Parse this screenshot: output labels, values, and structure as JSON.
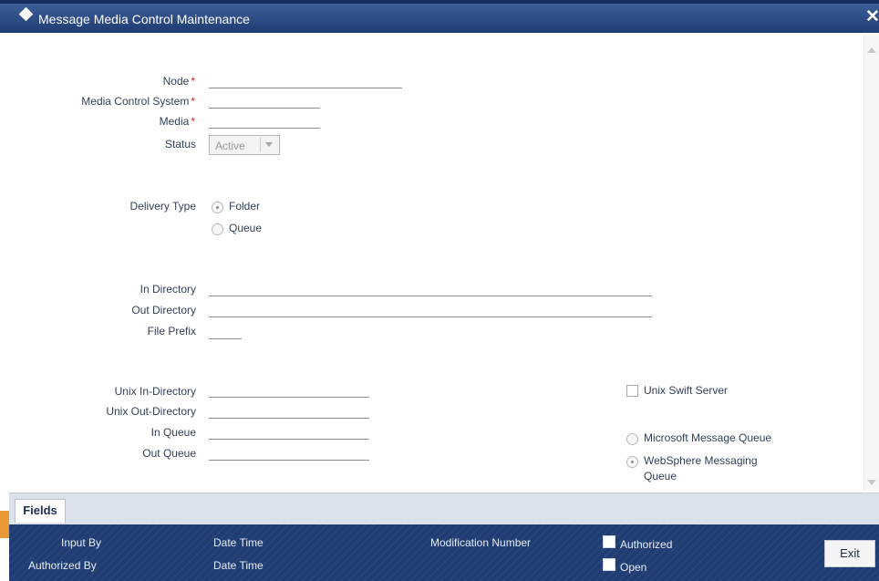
{
  "window": {
    "title": "Message Media Control Maintenance",
    "close_glyph": "✕"
  },
  "form": {
    "node": {
      "label": "Node",
      "required_mark": "*",
      "value": ""
    },
    "media_control_system": {
      "label": "Media Control System",
      "required_mark": "*",
      "value": ""
    },
    "media": {
      "label": "Media",
      "required_mark": "*",
      "value": ""
    },
    "status": {
      "label": "Status",
      "value": "Active"
    },
    "delivery_type": {
      "label": "Delivery Type",
      "options": [
        {
          "label": "Folder",
          "selected": true
        },
        {
          "label": "Queue",
          "selected": false
        }
      ]
    },
    "in_directory": {
      "label": "In Directory",
      "value": ""
    },
    "out_directory": {
      "label": "Out Directory",
      "value": ""
    },
    "file_prefix": {
      "label": "File Prefix",
      "value": ""
    },
    "unix_in_directory": {
      "label": "Unix In-Directory",
      "value": ""
    },
    "unix_out_directory": {
      "label": "Unix Out-Directory",
      "value": ""
    },
    "in_queue": {
      "label": "In Queue",
      "value": ""
    },
    "out_queue": {
      "label": "Out Queue",
      "value": ""
    },
    "unix_swift_server": {
      "label": "Unix Swift Server",
      "checked": false
    },
    "queue_type": {
      "options": [
        {
          "label": "Microsoft Message Queue",
          "selected": false
        },
        {
          "label_line1": "WebSphere Messaging",
          "label_line2": "Queue",
          "selected": true
        }
      ]
    }
  },
  "tabs": {
    "fields": "Fields"
  },
  "footer": {
    "input_by": "Input By",
    "authorized_by": "Authorized By",
    "date_time_1": "Date Time",
    "date_time_2": "Date Time",
    "modification_number": "Modification Number",
    "authorized": "Authorized",
    "open": "Open",
    "exit": "Exit"
  },
  "colors": {
    "header": "#2a4a86",
    "footer": "#1f3d73",
    "required": "#d21f1f",
    "accent": "#e99a35"
  },
  "icons": [
    "diamond-icon",
    "close-icon",
    "dropdown-arrow-icon",
    "scroll-up-icon",
    "scroll-down-icon"
  ]
}
